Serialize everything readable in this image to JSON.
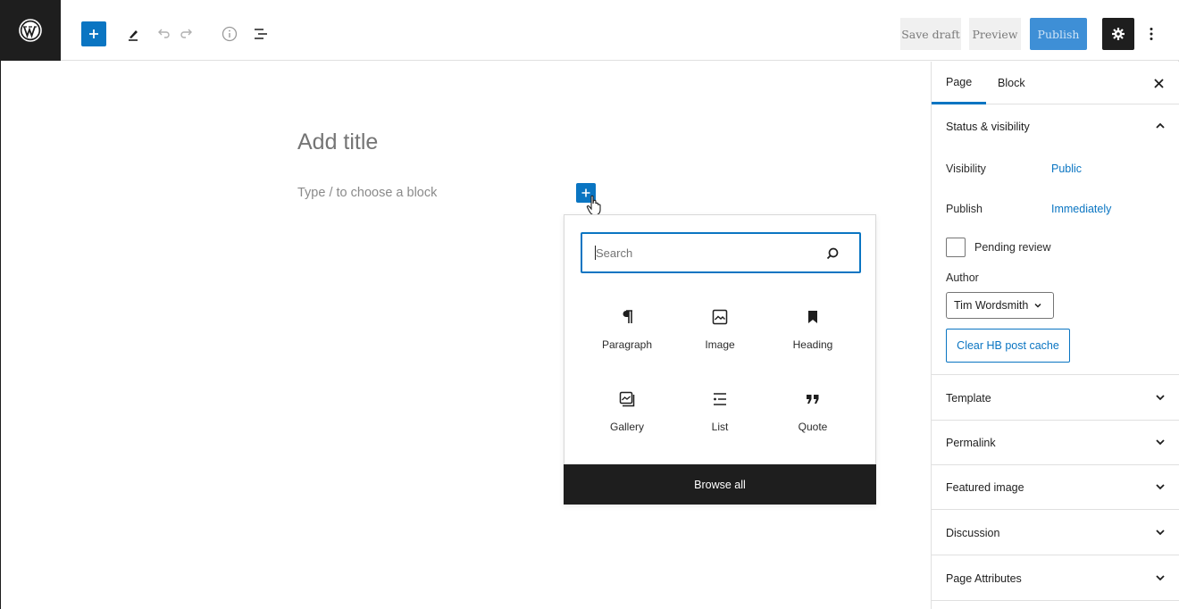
{
  "toolbar": {
    "save_draft_label": "Save draft",
    "preview_label": "Preview",
    "publish_label": "Publish"
  },
  "editor": {
    "title_placeholder": "Add title",
    "block_placeholder": "Type / to choose a block"
  },
  "inserter": {
    "search_placeholder": "Search",
    "blocks": [
      {
        "label": "Paragraph",
        "icon": "paragraph-icon"
      },
      {
        "label": "Image",
        "icon": "image-icon"
      },
      {
        "label": "Heading",
        "icon": "heading-icon"
      },
      {
        "label": "Gallery",
        "icon": "gallery-icon"
      },
      {
        "label": "List",
        "icon": "list-icon"
      },
      {
        "label": "Quote",
        "icon": "quote-icon"
      }
    ],
    "browse_all_label": "Browse all"
  },
  "sidebar": {
    "tabs": [
      "Page",
      "Block"
    ],
    "status_visibility": {
      "title": "Status & visibility",
      "visibility_label": "Visibility",
      "visibility_value": "Public",
      "publish_label": "Publish",
      "publish_value": "Immediately",
      "pending_review_label": "Pending review",
      "author_label": "Author",
      "author_value": "Tim Wordsmith",
      "clear_cache_label": "Clear HB post cache"
    },
    "panels": [
      "Template",
      "Permalink",
      "Featured image",
      "Discussion",
      "Page Attributes"
    ]
  },
  "colors": {
    "accent": "#0a75c2",
    "dark": "#1e1e1e"
  }
}
